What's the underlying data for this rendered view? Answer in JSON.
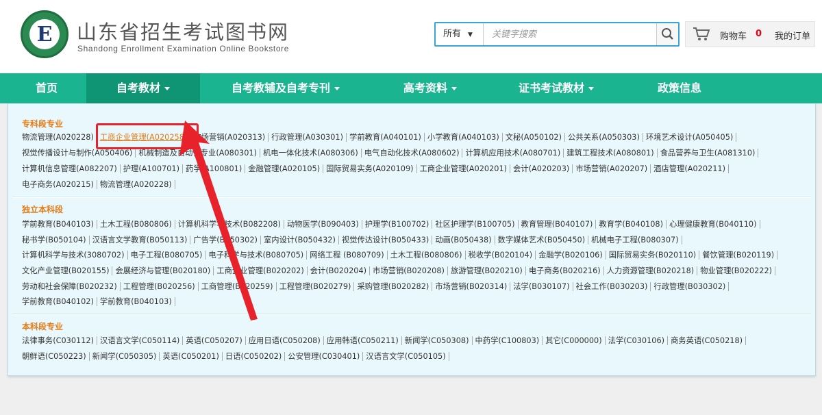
{
  "header": {
    "title": "山东省招生考试图书网",
    "subtitle": "Shandong Enrollment Examination Online Bookstore",
    "logo_letter": "E",
    "search": {
      "scope": "所有",
      "placeholder": "关键字搜索",
      "icon": "search-icon"
    },
    "cart": {
      "label": "购物车",
      "count": "0",
      "orders": "我的订单",
      "icon": "cart-icon"
    }
  },
  "nav": [
    {
      "label": "首页"
    },
    {
      "label": "自考教材",
      "active": true
    },
    {
      "label": "自考教辅及自考专刊"
    },
    {
      "label": "高考资料"
    },
    {
      "label": "证书考试教材"
    },
    {
      "label": "政策信息"
    }
  ],
  "sections": [
    {
      "title": "专科段专业",
      "rows": [
        [
          "物流管理(A020228)",
          "工商企业管理(A020258)",
          "市场营销(A020313)",
          "行政管理(A030301)",
          "学前教育(A040101)",
          "小学教育(A040103)",
          "文秘(A050102)",
          "公共关系(A050303)",
          "环境艺术设计(A050405)"
        ],
        [
          "视觉传播设计与制作(A050406)",
          "机械制造及自动化专业(A080301)",
          "机电一体化技术(A080306)",
          "电气自动化技术(A080602)",
          "计算机应用技术(A080701)",
          "建筑工程技术(A080801)",
          "食品营养与卫生(A081310)"
        ],
        [
          "计算机信息管理(A082207)",
          "护理(A100701)",
          "药学(A100801)",
          "金融管理(A020105)",
          "国际贸易实务(A020109)",
          "工商企业管理(A020201)",
          "会计(A020203)",
          "市场营销(A020207)",
          "酒店管理(A020211)"
        ],
        [
          "电子商务(A020215)",
          "物流管理(A020228)"
        ]
      ]
    },
    {
      "title": "独立本科段",
      "rows": [
        [
          "学前教育(B040103)",
          "土木工程(B080806)",
          "计算机科学与技术(B082208)",
          "动物医学(B090403)",
          "护理学(B100702)",
          "社区护理学(B100705)",
          "教育管理(B040107)",
          "教育学(B040108)",
          "心理健康教育(B040110)"
        ],
        [
          "秘书学(B050104)",
          "汉语言文学教育(B050113)",
          "广告学(B050302)",
          "室内设计(B050432)",
          "视觉传达设计(B050433)",
          "动画(B050438)",
          "数字媒体艺术(B050450)",
          "机械电子工程(B080307)"
        ],
        [
          "计算机科学与技术(3080702)",
          "电子工程(B080705)",
          "电子科学与技术(B080705)",
          "网络工程 (B080709)",
          "土木工程(B080806)",
          "税收学(B020104)",
          "金融学(B020106)",
          "国际贸易实务(B020110)",
          "餐饮管理(B020119)"
        ],
        [
          "文化产业管理(B020155)",
          "会展经济与管理(B020180)",
          "工商企业管理(B020202)",
          "会计(B020204)",
          "市场营销(B020208)",
          "旅游管理(B020210)",
          "电子商务(B020216)",
          "人力资源管理(B020218)",
          "物业管理(B020222)"
        ],
        [
          "劳动和社会保障(B020232)",
          "工程管理(B020256)",
          "工商管理(B020259)",
          "工程管理(B020279)",
          "采购管理(B020282)",
          "市场营销(B020314)",
          "法学(B030107)",
          "社会工作(B030203)",
          "行政管理(B030302)"
        ],
        [
          "学前教育(B040102)",
          "学前教育(B040103)"
        ]
      ]
    },
    {
      "title": "本科段专业",
      "rows": [
        [
          "法律事务(C030112)",
          "汉语言文学(C050114)",
          "英语(C050207)",
          "应用日语(C050208)",
          "应用韩语(C050211)",
          "新闻学(C050308)",
          "中药学(C100803)",
          "其它(C000000)",
          "法学(C030106)",
          "商务英语(C050218)"
        ],
        [
          "朝鲜语(C050223)",
          "新闻学(C050305)",
          "英语(C050201)",
          "日语(C050202)",
          "公安管理(C030401)",
          "汉语言文学(C050105)"
        ]
      ]
    }
  ],
  "highlight": "工商企业管理(A020258)"
}
